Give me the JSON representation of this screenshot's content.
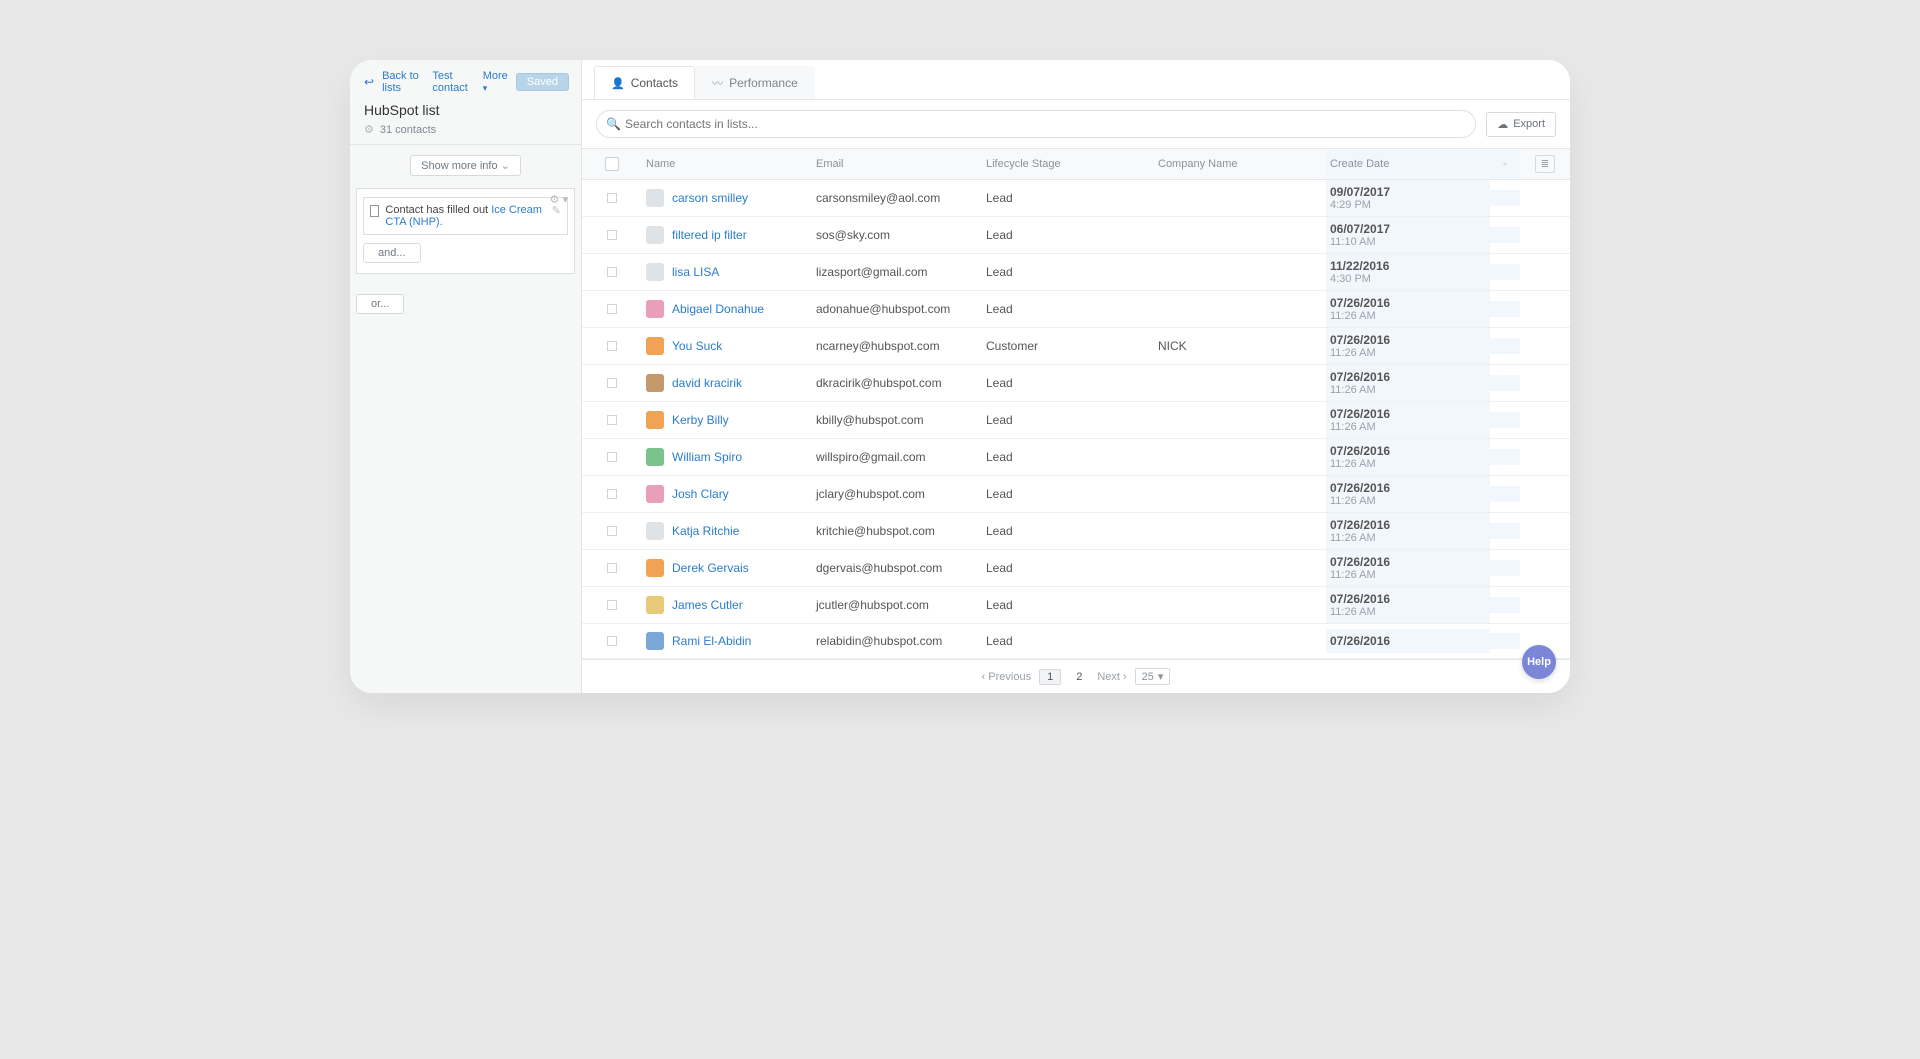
{
  "sidebar": {
    "back": "Back to lists",
    "test_contact": "Test contact",
    "more": "More",
    "saved": "Saved",
    "list_name": "HubSpot list",
    "contact_count": "31 contacts",
    "show_more": "Show more info",
    "rule_prefix": "Contact has filled out ",
    "rule_cta": "Ice Cream CTA (NHP).",
    "and": "and...",
    "or": "or..."
  },
  "tabs": {
    "contacts": "Contacts",
    "performance": "Performance"
  },
  "search": {
    "placeholder": "Search contacts in lists..."
  },
  "export_label": "Export",
  "columns": {
    "name": "Name",
    "email": "Email",
    "stage": "Lifecycle Stage",
    "company": "Company Name",
    "date": "Create Date",
    "dash": "-"
  },
  "rows": [
    {
      "name": "carson smilley",
      "email": "carsonsmiley@aol.com",
      "stage": "Lead",
      "company": "",
      "date": "09/07/2017",
      "time": "4:29 PM",
      "avatar": "av-gr"
    },
    {
      "name": "filtered ip filter",
      "email": "sos@sky.com",
      "stage": "Lead",
      "company": "",
      "date": "06/07/2017",
      "time": "11:10 AM",
      "avatar": "av-gr"
    },
    {
      "name": "lisa LISA",
      "email": "lizasport@gmail.com",
      "stage": "Lead",
      "company": "",
      "date": "11/22/2016",
      "time": "4:30 PM",
      "avatar": "av-gr"
    },
    {
      "name": "Abigael Donahue",
      "email": "adonahue@hubspot.com",
      "stage": "Lead",
      "company": "",
      "date": "07/26/2016",
      "time": "11:26 AM",
      "avatar": "av-pk"
    },
    {
      "name": "You Suck",
      "email": "ncarney@hubspot.com",
      "stage": "Customer",
      "company": "NICK",
      "date": "07/26/2016",
      "time": "11:26 AM",
      "avatar": "av-or"
    },
    {
      "name": "david kracirik",
      "email": "dkracirik@hubspot.com",
      "stage": "Lead",
      "company": "",
      "date": "07/26/2016",
      "time": "11:26 AM",
      "avatar": "av-br"
    },
    {
      "name": "Kerby Billy",
      "email": "kbilly@hubspot.com",
      "stage": "Lead",
      "company": "",
      "date": "07/26/2016",
      "time": "11:26 AM",
      "avatar": "av-or"
    },
    {
      "name": "William Spiro",
      "email": "willspiro@gmail.com",
      "stage": "Lead",
      "company": "",
      "date": "07/26/2016",
      "time": "11:26 AM",
      "avatar": "av-gn"
    },
    {
      "name": "Josh Clary",
      "email": "jclary@hubspot.com",
      "stage": "Lead",
      "company": "",
      "date": "07/26/2016",
      "time": "11:26 AM",
      "avatar": "av-pk"
    },
    {
      "name": "Katja Ritchie",
      "email": "kritchie@hubspot.com",
      "stage": "Lead",
      "company": "",
      "date": "07/26/2016",
      "time": "11:26 AM",
      "avatar": "av-gr"
    },
    {
      "name": "Derek Gervais",
      "email": "dgervais@hubspot.com",
      "stage": "Lead",
      "company": "",
      "date": "07/26/2016",
      "time": "11:26 AM",
      "avatar": "av-or"
    },
    {
      "name": "James Cutler",
      "email": "jcutler@hubspot.com",
      "stage": "Lead",
      "company": "",
      "date": "07/26/2016",
      "time": "11:26 AM",
      "avatar": "av-yl"
    },
    {
      "name": "Rami El-Abidin",
      "email": "relabidin@hubspot.com",
      "stage": "Lead",
      "company": "",
      "date": "07/26/2016",
      "time": "",
      "avatar": "av-bl"
    }
  ],
  "pagination": {
    "prev": "Previous",
    "p1": "1",
    "p2": "2",
    "next": "Next",
    "size": "25"
  },
  "help": "Help"
}
